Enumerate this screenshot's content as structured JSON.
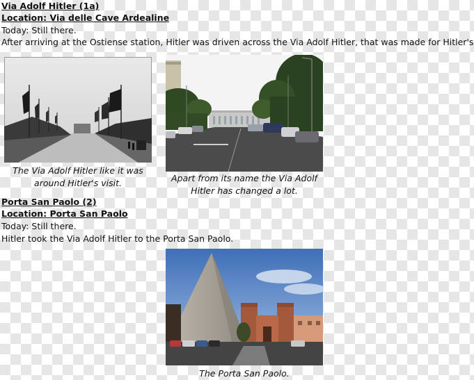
{
  "section1": {
    "title": "Via Adolf Hitler (1a)",
    "location": "Location: Via delle Cave Ardealine",
    "today": "Today: Still there.",
    "text": "After arriving at the Ostiense station, Hitler was driven across the Via Adolf Hitler, that was made for Hitler's visit.",
    "photo_old": {
      "caption_line1": "The Via Adolf Hitler like it was",
      "caption_line2": "around Hitler's visit."
    },
    "photo_new": {
      "caption_line1": "Apart from its name the Via Adolf",
      "caption_line2": "Hitler has changed a lot."
    }
  },
  "section2": {
    "title": "Porta San Paolo (2)",
    "location": "Location: Porta San Paolo",
    "today": "Today: Still there.",
    "text": "Hitler took the Via Adolf Hitler to the Porta San Paolo.",
    "photo": {
      "caption": "The Porta San Paolo."
    }
  }
}
